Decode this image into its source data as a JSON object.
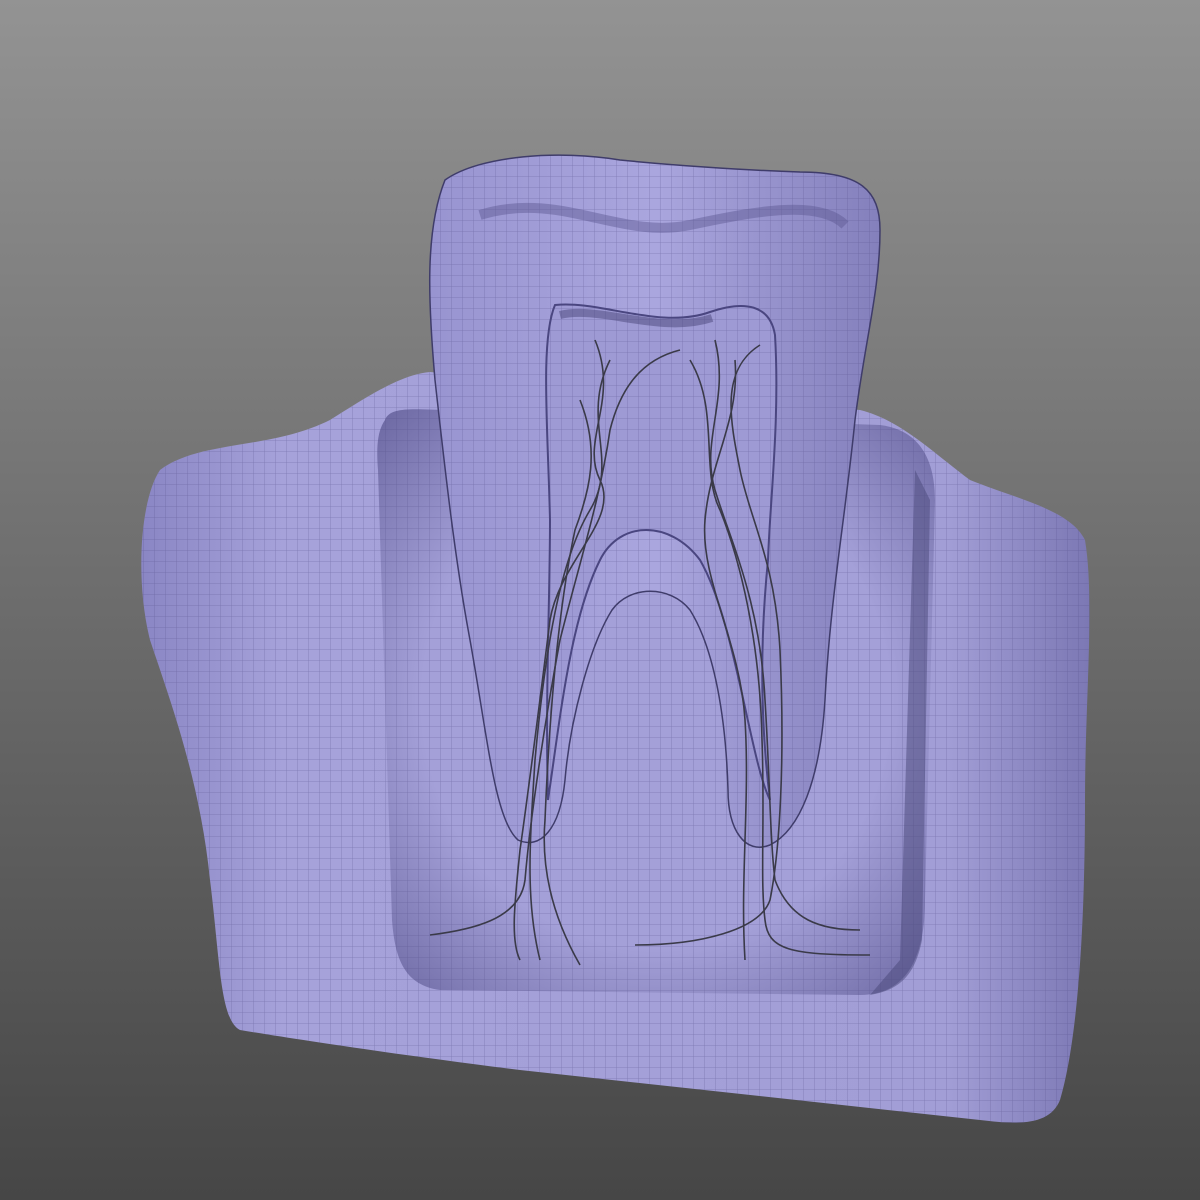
{
  "scene": {
    "subject": "tooth-cross-section-model",
    "colors": {
      "background_top": "#929292",
      "background_bottom": "#474747",
      "surface": "#a29ed6",
      "surface_shadow": "#6e6aa4",
      "mesh_line": "#4b4680",
      "nerve_line": "#3a3a48"
    }
  }
}
